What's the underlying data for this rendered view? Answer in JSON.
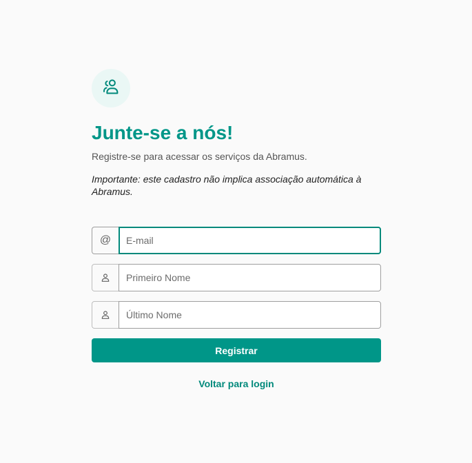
{
  "header": {
    "title": "Junte-se a nós!",
    "subtitle": "Registre-se para acessar os serviços da Abramus.",
    "notice": "Importante: este cadastro não implica associação automática à Abramus.",
    "icon": "users-icon"
  },
  "form": {
    "email": {
      "addon": "@",
      "placeholder": "E-mail",
      "value": ""
    },
    "first_name": {
      "icon": "user-icon",
      "placeholder": "Primeiro Nome",
      "value": ""
    },
    "last_name": {
      "icon": "user-icon",
      "placeholder": "Último Nome",
      "value": ""
    },
    "submit_label": "Registrar"
  },
  "footer": {
    "back_label": "Voltar para login"
  },
  "colors": {
    "accent": "#009688",
    "background": "#fafafa"
  }
}
